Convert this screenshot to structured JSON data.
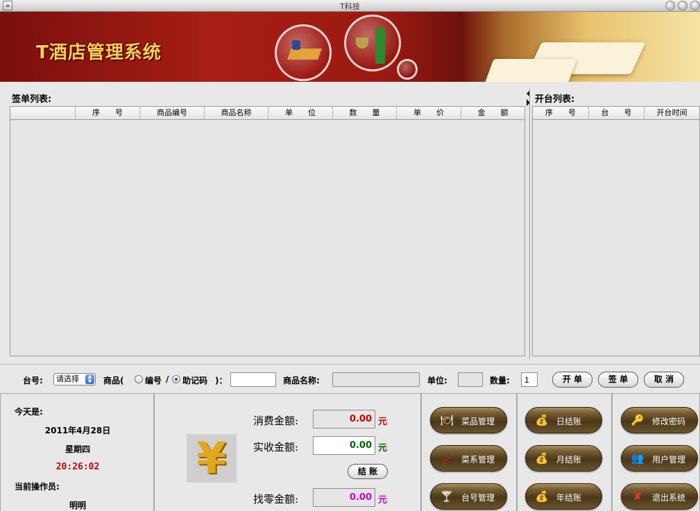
{
  "window": {
    "title": "T科技",
    "app_icon": "java-icon"
  },
  "banner": {
    "brand": "T酒店管理系统"
  },
  "order_list": {
    "label": "签单列表:",
    "columns": [
      "",
      "序　　号",
      "商品编号",
      "商品名称",
      "单　　位",
      "数　　量",
      "单　　价",
      "金　　额"
    ],
    "rows": []
  },
  "table_list": {
    "label": "开台列表:",
    "columns": [
      "序　　号",
      "台　　号",
      "开台时间"
    ],
    "rows": []
  },
  "controls": {
    "table_no_label": "台号:",
    "table_no_value": "请选择",
    "goods_label": "商品(",
    "radio_code": "编号",
    "slash": "/",
    "radio_help": "助记码",
    "close_paren": ")：",
    "goods_input": "",
    "goods_name_label": "商品名称:",
    "goods_name_value": "",
    "unit_label": "单位:",
    "unit_value": "",
    "qty_label": "数量:",
    "qty_value": "1",
    "open_btn": "开 单",
    "sign_btn": "签 单",
    "cancel_btn": "取 消"
  },
  "status": {
    "today_label": "今天是:",
    "date": "2011年4月28日",
    "weekday": "星期四",
    "time": "20:26:02",
    "operator_label": "当前操作员:",
    "operator": "明明"
  },
  "checkout": {
    "consume_label": "消费金额:",
    "consume_value": "0.00",
    "received_label": "实收金额:",
    "received_value": "0.00",
    "change_label": "找零金额:",
    "change_value": "0.00",
    "unit": "元",
    "settle_btn": "结 账"
  },
  "functions": [
    {
      "label": "菜品管理",
      "icon": "dish-icon"
    },
    {
      "label": "菜系管理",
      "icon": "cuisine-icon"
    },
    {
      "label": "台号管理",
      "icon": "table-icon"
    },
    {
      "label": "日结账",
      "icon": "daily-bill-icon"
    },
    {
      "label": "月结账",
      "icon": "monthly-bill-icon"
    },
    {
      "label": "年结账",
      "icon": "yearly-bill-icon"
    },
    {
      "label": "修改密码",
      "icon": "key-icon"
    },
    {
      "label": "用户管理",
      "icon": "users-icon"
    },
    {
      "label": "退出系统",
      "icon": "exit-icon"
    }
  ],
  "colors": {
    "consume": "#cc0000",
    "received": "#006600",
    "change": "#cc00cc",
    "time": "#cc0000"
  }
}
